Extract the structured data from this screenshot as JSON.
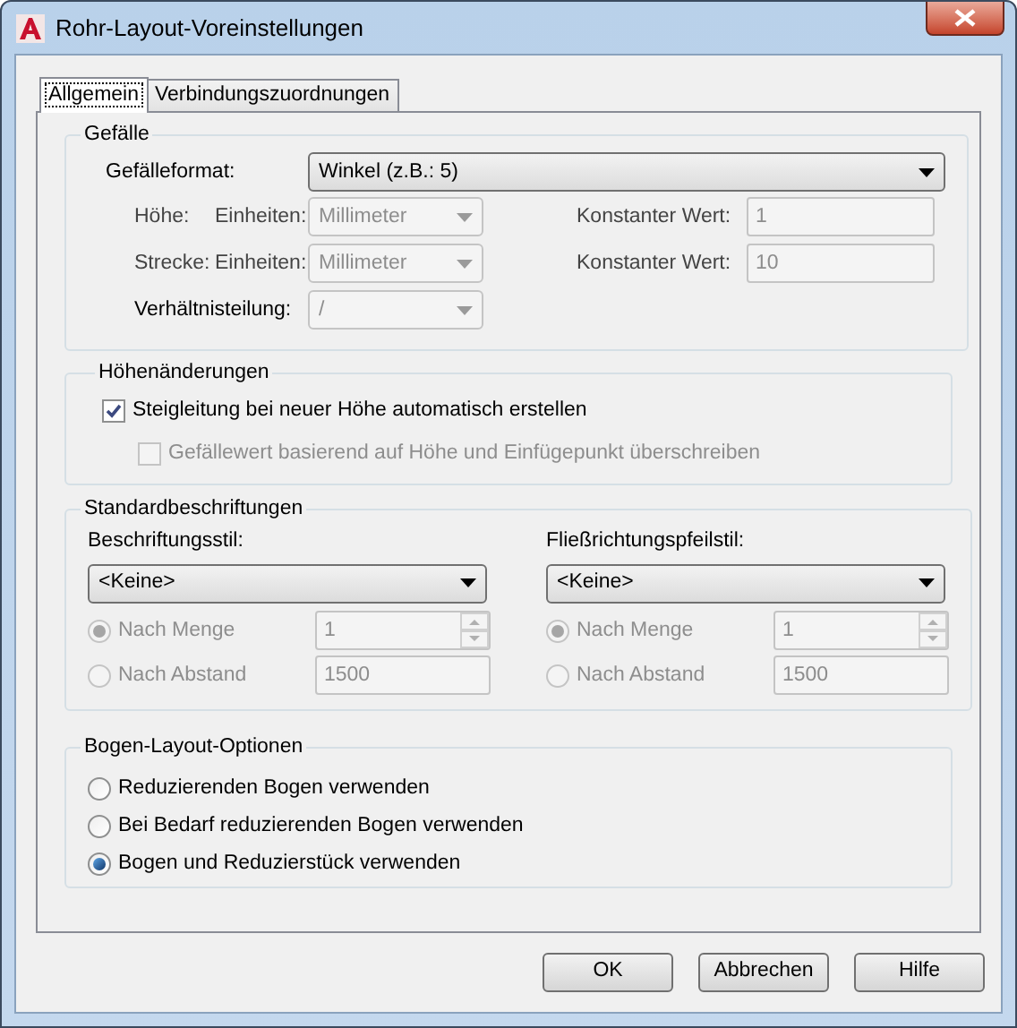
{
  "window": {
    "title": "Rohr-Layout-Voreinstellungen"
  },
  "tabs": [
    {
      "label": "Allgemein",
      "selected": true
    },
    {
      "label": "Verbindungszuordnungen",
      "selected": false
    }
  ],
  "slope": {
    "title": "Gefälle",
    "format_label": "Gefälleformat:",
    "format_value": "Winkel (z.B.: 5)",
    "rows": [
      {
        "label": "Höhe:",
        "units_label": "Einheiten:",
        "units_value": "Millimeter",
        "constant_label": "Konstanter Wert:",
        "constant_value": "1",
        "disabled": true
      },
      {
        "label": "Strecke:",
        "units_label": "Einheiten:",
        "units_value": "Millimeter",
        "constant_label": "Konstanter Wert:",
        "constant_value": "10",
        "disabled": true
      }
    ],
    "ratio_label": "Verhältnisteilung:",
    "ratio_value": "/",
    "ratio_disabled": true
  },
  "elevation": {
    "title": "Höhenänderungen",
    "options": [
      {
        "label": "Steigleitung bei neuer Höhe automatisch erstellen",
        "checked": true,
        "disabled": false,
        "children": [
          {
            "label": "Gefällewert basierend auf Höhe und Einfügepunkt überschreiben",
            "checked": false,
            "disabled": true
          }
        ]
      }
    ]
  },
  "annotations": {
    "title": "Standardbeschriftungen",
    "columns": [
      {
        "style_label": "Beschriftungsstil:",
        "style_value": "<Keine>",
        "options": [
          {
            "label": "Nach Menge",
            "selected": true,
            "disabled": true,
            "kind": "spinner",
            "value": "1"
          },
          {
            "label": "Nach Abstand",
            "selected": false,
            "disabled": true,
            "kind": "text",
            "value": "1500"
          }
        ]
      },
      {
        "style_label": "Fließrichtungspfeilstil:",
        "style_value": "<Keine>",
        "options": [
          {
            "label": "Nach Menge",
            "selected": true,
            "disabled": true,
            "kind": "spinner",
            "value": "1"
          },
          {
            "label": "Nach Abstand",
            "selected": false,
            "disabled": true,
            "kind": "text",
            "value": "1500"
          }
        ]
      }
    ]
  },
  "bend": {
    "title": "Bogen-Layout-Optionen",
    "options": [
      {
        "label": "Reduzierenden Bogen verwenden",
        "selected": false
      },
      {
        "label": "Bei Bedarf reduzierenden Bogen verwenden",
        "selected": false
      },
      {
        "label": "Bogen und Reduzierstück verwenden",
        "selected": true
      }
    ]
  },
  "buttons": [
    "OK",
    "Abbrechen",
    "Hilfe"
  ]
}
